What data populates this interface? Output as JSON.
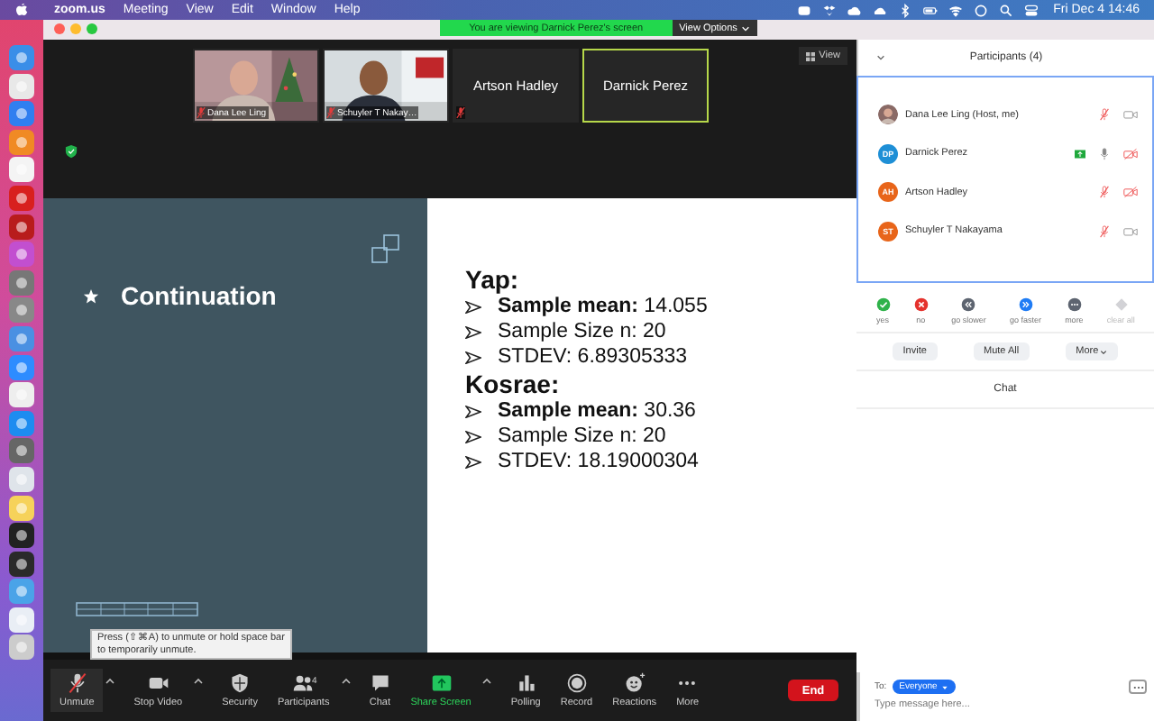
{
  "menu_bar": {
    "items": [
      {
        "label": "zoom.us",
        "bold": true
      },
      {
        "label": "Meeting",
        "bold": false
      },
      {
        "label": "View",
        "bold": false
      },
      {
        "label": "Edit",
        "bold": false
      },
      {
        "label": "Window",
        "bold": false
      },
      {
        "label": "Help",
        "bold": false
      }
    ],
    "clock": "Fri Dec 4  14:46"
  },
  "banner": {
    "text": "You are viewing Darnick Perez's screen",
    "options_button": "View Options"
  },
  "video_strip": {
    "tiles": [
      {
        "name": "Dana Lee Ling",
        "kind": "video",
        "muted": true,
        "speaking": false
      },
      {
        "name": "Schuyler T Nakay…",
        "kind": "video",
        "muted": true,
        "speaking": false
      },
      {
        "name": "Artson Hadley",
        "kind": "name",
        "muted": true,
        "speaking": false
      },
      {
        "name": "Darnick Perez",
        "kind": "name",
        "muted": false,
        "speaking": true
      }
    ],
    "view_button": "View"
  },
  "slide": {
    "title": "Continuation",
    "sections": [
      {
        "heading": "Yap:",
        "items": [
          "**Sample mean:** 14.055",
          "Sample Size n: 20",
          "STDEV: 6.89305333"
        ]
      },
      {
        "heading": "Kosrae:",
        "items": [
          "**Sample mean:** 30.36",
          "Sample Size n: 20",
          "STDEV: 18.19000304"
        ]
      }
    ]
  },
  "tooltip": "Press  (⇧⌘A) to unmute or hold space bar to temporarily unmute.",
  "toolbar": {
    "items": [
      {
        "label": "Unmute",
        "kind": "mic",
        "caret": true
      },
      {
        "label": "Stop Video",
        "kind": "video",
        "caret": true
      },
      {
        "label": "Security",
        "kind": "security",
        "caret": false
      },
      {
        "label": "Participants",
        "kind": "participants",
        "caret": true,
        "count": "4"
      },
      {
        "label": "Chat",
        "kind": "chat",
        "caret": false
      },
      {
        "label": "Share Screen",
        "kind": "share",
        "caret": true
      },
      {
        "label": "Polling",
        "kind": "polling",
        "caret": false
      },
      {
        "label": "Record",
        "kind": "record",
        "caret": false
      },
      {
        "label": "Reactions",
        "kind": "reactions",
        "caret": false
      },
      {
        "label": "More",
        "kind": "more",
        "caret": false
      }
    ],
    "end_button": "End"
  },
  "participants_panel": {
    "title": "Participants (4)",
    "participants": [
      {
        "name": "Dana Lee Ling (Host, me)",
        "mic_muted": true,
        "video_off": false,
        "sharing": false
      },
      {
        "name": "Darnick Perez",
        "kind": "initials",
        "initials": "DP",
        "color": "#1e8fd6",
        "mic_muted": false,
        "video_off": true,
        "sharing": true
      },
      {
        "name": "Artson Hadley",
        "kind": "initials",
        "initials": "AH",
        "color": "#e8651a",
        "mic_muted": true,
        "video_off": true,
        "sharing": false
      },
      {
        "name": "Schuyler T Nakayama",
        "kind": "initials",
        "initials": "ST",
        "color": "#e8651a",
        "mic_muted": true,
        "video_off": false,
        "sharing": false
      }
    ],
    "reactions": [
      {
        "label": "yes",
        "kind": "yes",
        "color": "#2fb24a",
        "disabled": false
      },
      {
        "label": "no",
        "kind": "no",
        "color": "#e5322d",
        "disabled": false
      },
      {
        "label": "go slower",
        "kind": "slower",
        "color": "#5d6470",
        "disabled": false
      },
      {
        "label": "go faster",
        "kind": "faster",
        "color": "#1f7cf5",
        "disabled": false
      },
      {
        "label": "more",
        "kind": "more",
        "color": "#5d6470",
        "disabled": false
      },
      {
        "label": "clear all",
        "kind": "clear",
        "color": "#d2d2d6",
        "disabled": true
      }
    ],
    "buttons": [
      {
        "label": "Invite",
        "caret": false
      },
      {
        "label": "Mute All",
        "caret": false
      },
      {
        "label": "More",
        "caret": true
      }
    ]
  },
  "chat": {
    "title": "Chat",
    "to_label": "To:",
    "recipient": "Everyone",
    "placeholder": "Type message here..."
  }
}
